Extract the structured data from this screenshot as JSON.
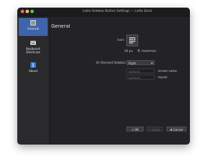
{
  "window": {
    "title": "Latte Sidebar Button Settings — Latte Dock"
  },
  "sidebar": {
    "items": [
      {
        "label": "General",
        "icon": "general-settings-icon",
        "active": true
      },
      {
        "label": "Keyboard\nShortcuts",
        "label_lines": [
          "Keyboard",
          "Shortcuts"
        ],
        "icon": "keyboard-icon",
        "active": false
      },
      {
        "label": "About",
        "icon": "info-icon",
        "active": false
      }
    ]
  },
  "main": {
    "page_title": "General",
    "icon_label": "Icon:",
    "size_value": "20 px.",
    "maximum_label": "maximum",
    "on_demand_label": "On Demand Sidebar:",
    "on_demand_value": "Right",
    "screen_name_placeholder": "optional",
    "screen_name_label": "screen name",
    "layout_placeholder": "optional",
    "layout_label": "layout"
  },
  "buttons": {
    "ok": "OK",
    "apply": "Apply",
    "cancel": "Cancel"
  },
  "colors": {
    "accent": "#3f64a8",
    "window_bg": "#232326",
    "sidebar_bg": "#2a2a2d"
  }
}
